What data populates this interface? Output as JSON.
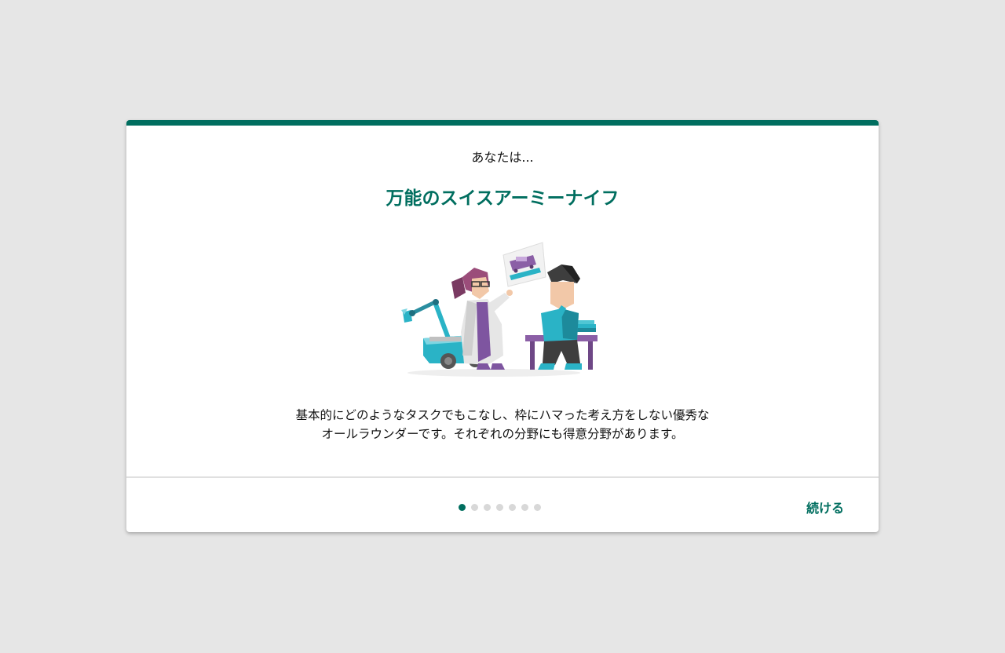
{
  "card": {
    "subtitle": "あなたは...",
    "title": "万能のスイスアーミーナイフ",
    "description_line1": "基本的にどのようなタスクでもこなし、枠にハマった考え方をしない優秀な",
    "description_line2": "オールラウンダーです。それぞれの分野にも得意分野があります。",
    "illustration_icon": "scientists-robot-illustration"
  },
  "pagination": {
    "total_steps": 7,
    "current_step": 1
  },
  "footer": {
    "continue_label": "続ける"
  },
  "colors": {
    "accent": "#006e5f",
    "background": "#e6e6e6",
    "card": "#ffffff",
    "inactive_dot": "#d8d8d8"
  }
}
